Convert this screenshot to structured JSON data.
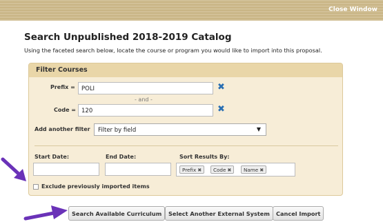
{
  "header": {
    "close_label": "Close Window"
  },
  "page": {
    "title": "Search Unpublished 2018-2019 Catalog",
    "subtitle": "Using the faceted search below, locate the course or program you would like to import into this proposal."
  },
  "filter": {
    "title": "Filter Courses",
    "prefix_label": "Prefix =",
    "prefix_value": "POLI",
    "and_text": "- and -",
    "code_label": "Code =",
    "code_value": "120",
    "remove_icon": "close-x-icon",
    "add_filter_label": "Add another filter",
    "add_filter_selected": "Filter by field",
    "start_date_label": "Start Date:",
    "start_date_value": "",
    "end_date_label": "End Date:",
    "end_date_value": "",
    "sort_label": "Sort Results By:",
    "sort_chips": [
      {
        "label": "Prefix",
        "x": "✖"
      },
      {
        "label": "Code",
        "x": "✖"
      },
      {
        "label": "Name",
        "x": "✖"
      }
    ],
    "exclude_label": "Exclude previously imported items",
    "exclude_checked": false
  },
  "buttons": {
    "search": "Search Available Curriculum",
    "select_system": "Select Another External System",
    "cancel": "Cancel Import"
  },
  "colors": {
    "header_bar": "#d2c097",
    "panel_bg": "#f7edd7",
    "panel_head": "#e9d6a8",
    "remove_blue": "#2a6fb3",
    "annotation_arrow": "#6a32b8"
  }
}
